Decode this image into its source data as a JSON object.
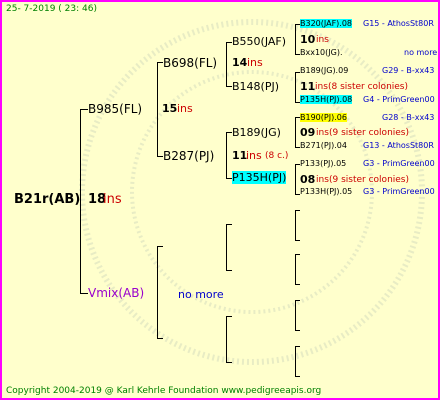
{
  "header": {
    "timestamp": "25-  7-2019  ( 23: 46)"
  },
  "footer": {
    "copyright": "Copyright 2004-2019 @ Karl Kehrle Foundation   www.pedigreeapis.org"
  },
  "root": {
    "id": "B21r(AB)",
    "ins_num": "18",
    "ins_label": "ins"
  },
  "gen1": {
    "top": {
      "id": "B985(FL)",
      "ins_num": "15",
      "ins_label": "ins"
    },
    "bottom": {
      "id": "Vmix(AB)",
      "note": "no more"
    }
  },
  "gen2": {
    "b698": {
      "id": "B698(FL)",
      "ins_num": "14",
      "ins_label": "ins"
    },
    "b287": {
      "id": "B287(PJ)",
      "ins_num": "11",
      "ins_label": "ins",
      "extra": "(8 c.)"
    }
  },
  "gen3": {
    "b550": {
      "id": "B550(JAF)",
      "ins_num": "10",
      "ins_label": "ins"
    },
    "b148": {
      "id": "B148(PJ)",
      "ins_num": "11",
      "ins_label": "ins",
      "note": "(8 sister colonies)"
    },
    "b189jg": {
      "id": "B189(JG)",
      "ins_num": "09",
      "ins_label": "ins",
      "note": "(9 sister colonies)"
    },
    "p135": {
      "id": "P135H(PJ)",
      "ins_num": "08",
      "ins_label": "ins",
      "note": "(9 sister colonies)"
    }
  },
  "gen4": [
    {
      "text": "B320(JAF).08",
      "source": "G15 - AthosSt80R",
      "hl": "cyan"
    },
    {
      "text": "Bxx10(JG).",
      "source": "no more",
      "hl": ""
    },
    {
      "text": "B189(JG).09",
      "source": "G29 - B-xx43",
      "hl": ""
    },
    {
      "text": "P135H(PJ).08",
      "source": "G4 - PrimGreen00",
      "hl": "cyan"
    },
    {
      "text": "B190(PJ).06",
      "source": "G28 - B-xx43",
      "hl": "yellow"
    },
    {
      "text": "B271(PJ).04",
      "source": "G13 - AthosSt80R",
      "hl": ""
    },
    {
      "text": "P133(PJ).05",
      "source": "G3 - PrimGreen00",
      "hl": ""
    },
    {
      "text": "P133H(PJ).05",
      "source": "G3 - PrimGreen00",
      "hl": ""
    }
  ],
  "colors": {
    "border": "#ff00ff",
    "background": "#ffffcc",
    "text_green": "#008000",
    "text_blue": "#0000cc",
    "ins_red": "#cc0000",
    "highlight_cyan": "#00ffff",
    "highlight_yellow": "#ffff00"
  }
}
